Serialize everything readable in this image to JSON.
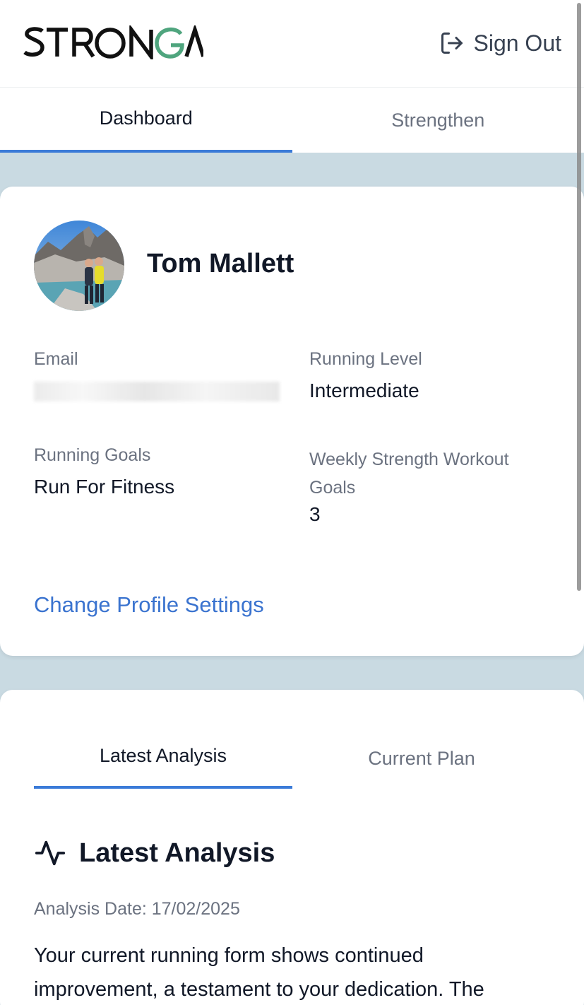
{
  "header": {
    "logo_text": "STRONGA",
    "sign_out_label": "Sign Out"
  },
  "top_tabs": [
    {
      "label": "Dashboard",
      "active": true
    },
    {
      "label": "Strengthen",
      "active": false
    }
  ],
  "profile": {
    "name": "Tom Mallett",
    "email_label": "Email",
    "running_level_label": "Running Level",
    "running_level_value": "Intermediate",
    "running_goals_label": "Running Goals",
    "running_goals_value": "Run For Fitness",
    "weekly_strength_label": "Weekly Strength Workout Goals",
    "weekly_strength_value": "3",
    "change_settings_label": "Change Profile Settings"
  },
  "analysis_tabs": [
    {
      "label": "Latest Analysis",
      "active": true
    },
    {
      "label": "Current Plan",
      "active": false
    }
  ],
  "analysis": {
    "icon": "activity-pulse-icon",
    "title": "Latest Analysis",
    "date_text": "Analysis Date: 17/02/2025",
    "body_text": "Your current running form shows continued improvement, a testament to your dedication. The"
  },
  "colors": {
    "accent": "#3b7bd8",
    "link": "#3a73cf",
    "page_bg": "#c9dae2",
    "logo_accent": "#55a57a"
  }
}
